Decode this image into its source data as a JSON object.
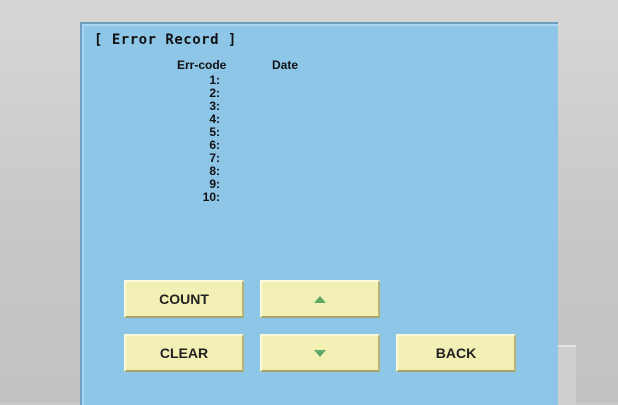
{
  "screen": {
    "title": "[ Error Record ]",
    "columns": {
      "code": "Err-code",
      "date": "Date"
    },
    "rows": [
      {
        "index": "1:"
      },
      {
        "index": "2:"
      },
      {
        "index": "3:"
      },
      {
        "index": "4:"
      },
      {
        "index": "5:"
      },
      {
        "index": "6:"
      },
      {
        "index": "7:"
      },
      {
        "index": "8:"
      },
      {
        "index": "9:"
      },
      {
        "index": "10:"
      }
    ]
  },
  "buttons": {
    "count": "COUNT",
    "clear": "CLEAR",
    "back": "BACK",
    "up_icon": "triangle-up-icon",
    "down_icon": "triangle-down-icon"
  },
  "colors": {
    "screen_bg": "#8ec6e8",
    "button_bg": "#f2f0b4",
    "arrow": "#5fa86a",
    "bezel": "#c9c9c7"
  }
}
